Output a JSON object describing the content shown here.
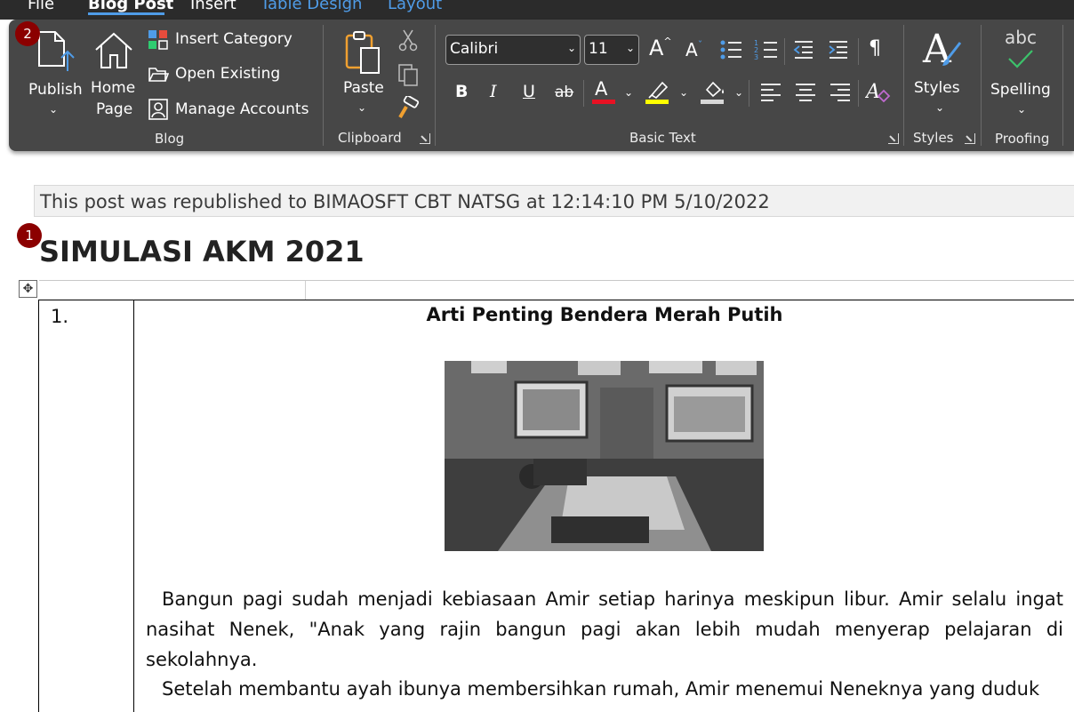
{
  "tabs": [
    {
      "label": "File"
    },
    {
      "label": "Blog Post"
    },
    {
      "label": "Insert"
    },
    {
      "label": "Table Design"
    },
    {
      "label": "Layout"
    }
  ],
  "ribbon": {
    "blog": {
      "publish_label": "Publish",
      "home_label_line1": "Home",
      "home_label_line2": "Page",
      "insert_category": "Insert Category",
      "open_existing": "Open Existing",
      "manage_accounts": "Manage Accounts",
      "group_label": "Blog"
    },
    "clipboard": {
      "paste_label": "Paste",
      "group_label": "Clipboard"
    },
    "basic_text": {
      "font_name": "Calibri",
      "font_size": "11",
      "grow_font": "A",
      "shrink_font": "A",
      "bold": "B",
      "italic": "I",
      "underline": "U",
      "strikethrough": "ab",
      "font_color_letter": "A",
      "font_color": "#e81123",
      "highlight_color": "#ffff00",
      "pilcrow": "¶",
      "group_label": "Basic Text"
    },
    "styles": {
      "styles_label": "Styles",
      "glyph": "A",
      "group_label": "Styles"
    },
    "proofing": {
      "abc": "abc",
      "spelling_label": "Spelling",
      "group_label": "Proofing"
    }
  },
  "badges": {
    "badge_ribbon": "2",
    "badge_title": "1"
  },
  "document": {
    "notice": "This post was republished to BIMAOSFT CBT NATSG at 12:14:10 PM 5/10/2022",
    "title": "SIMULASI AKM 2021",
    "question_number": "1.",
    "article_title": "Arti Penting Bendera Merah Putih",
    "paragraph1": "Bangun pagi sudah menjadi kebiasaan Amir setiap harinya meskipun libur. Amir selalu ingat nasihat Nenek, \"Anak yang rajin bangun pagi akan lebih mudah menyerap pelajaran di sekolahnya.",
    "paragraph2": "Setelah membantu ayah ibunya membersihkan rumah, Amir menemui Neneknya yang duduk"
  }
}
